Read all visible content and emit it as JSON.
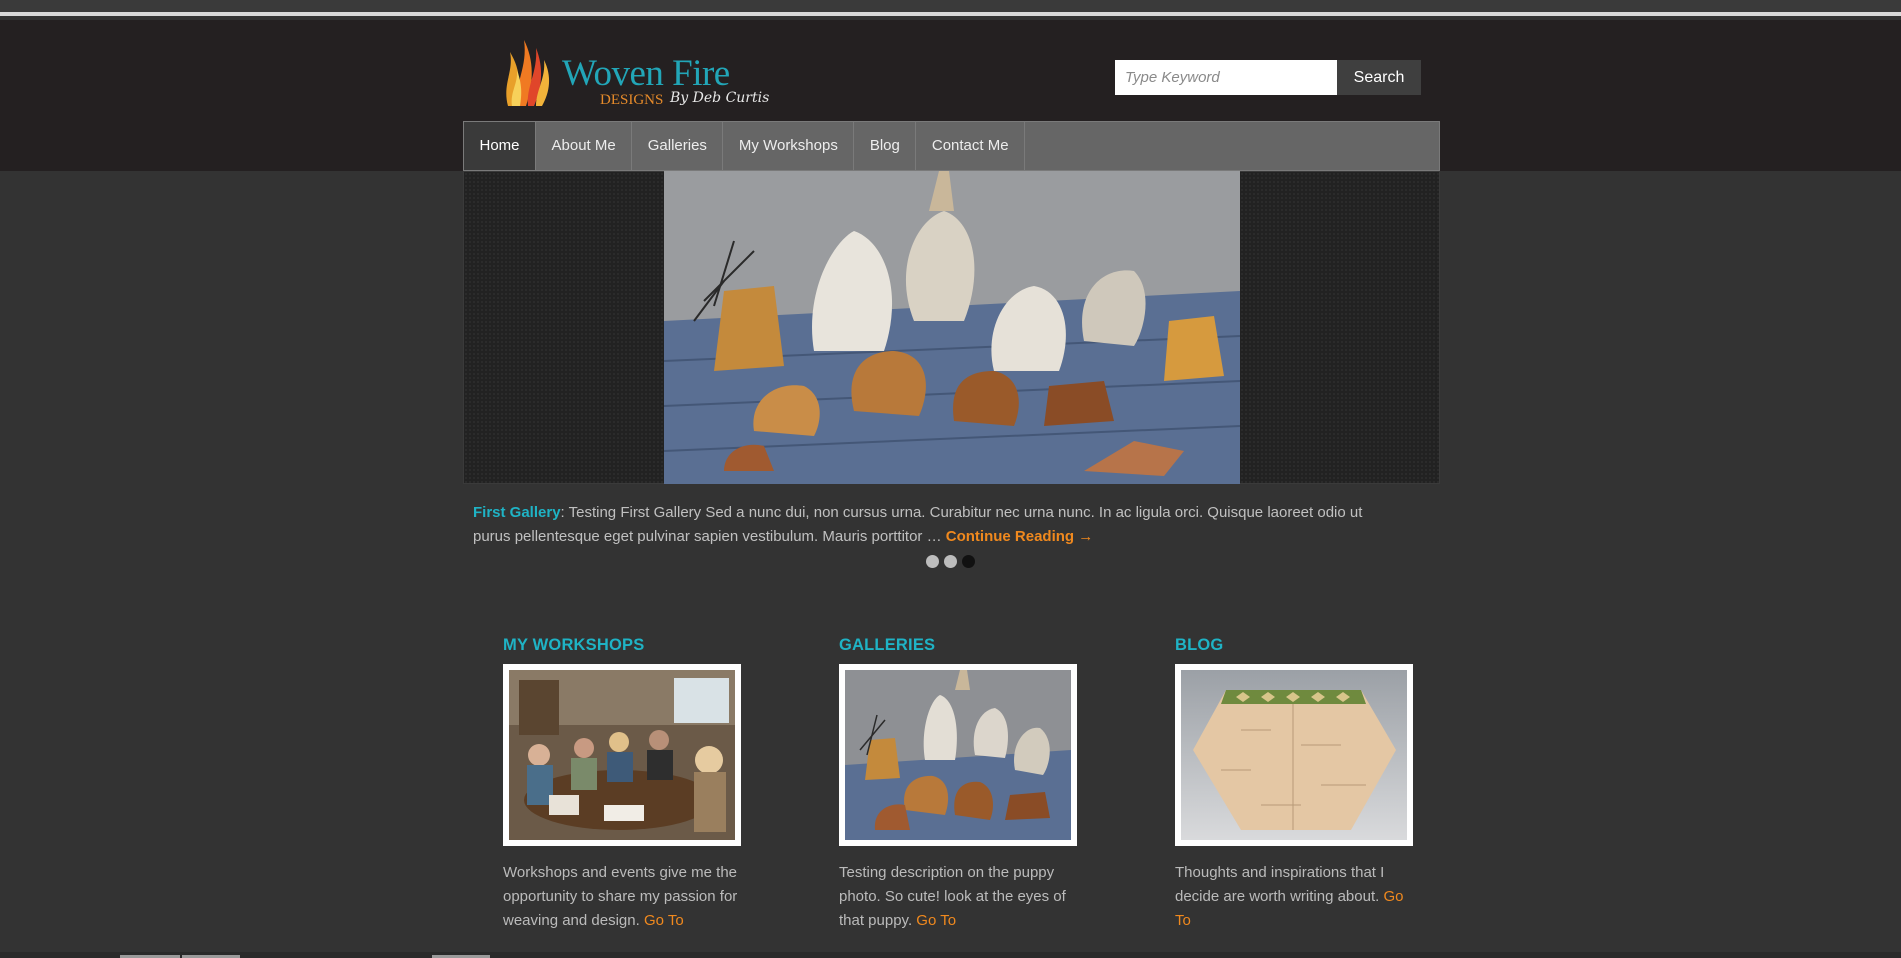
{
  "brand": {
    "title": "Woven Fire",
    "designs": "DESIGNS",
    "byline": "By Deb Curtis"
  },
  "search": {
    "placeholder": "Type Keyword",
    "button_label": "Search"
  },
  "nav": {
    "items": [
      {
        "label": "Home",
        "active": true
      },
      {
        "label": "About Me"
      },
      {
        "label": "Galleries"
      },
      {
        "label": "My Workshops"
      },
      {
        "label": "Blog"
      },
      {
        "label": "Contact Me"
      }
    ]
  },
  "slider": {
    "gallery_name": "First Gallery",
    "separator": ": ",
    "text": "Testing First Gallery Sed a nunc dui, non cursus urna. Curabitur nec urna nunc. In ac ligula orci. Quisque laoreet odio ut purus pellentesque eget pulvinar sapien vestibulum. Mauris porttitor … ",
    "continue_label": "Continue Reading →",
    "dots": 3,
    "active_dot": 3
  },
  "columns": [
    {
      "heading": "MY WORKSHOPS",
      "text": "Workshops and events give me the opportunity to share my passion for weaving and design. ",
      "link": "Go To"
    },
    {
      "heading": "GALLERIES",
      "text": "Testing description on the puppy photo. So cute! look at the eyes of that  puppy. ",
      "link": "Go To"
    },
    {
      "heading": "BLOG",
      "text": "Thoughts and inspirations that I decide are worth writing about. ",
      "link": "Go To"
    }
  ],
  "colors": {
    "accent_teal": "#1fb3c5",
    "accent_orange": "#f0891e",
    "header_bg": "#242021",
    "page_bg": "#333333",
    "nav_bg": "#666666"
  }
}
